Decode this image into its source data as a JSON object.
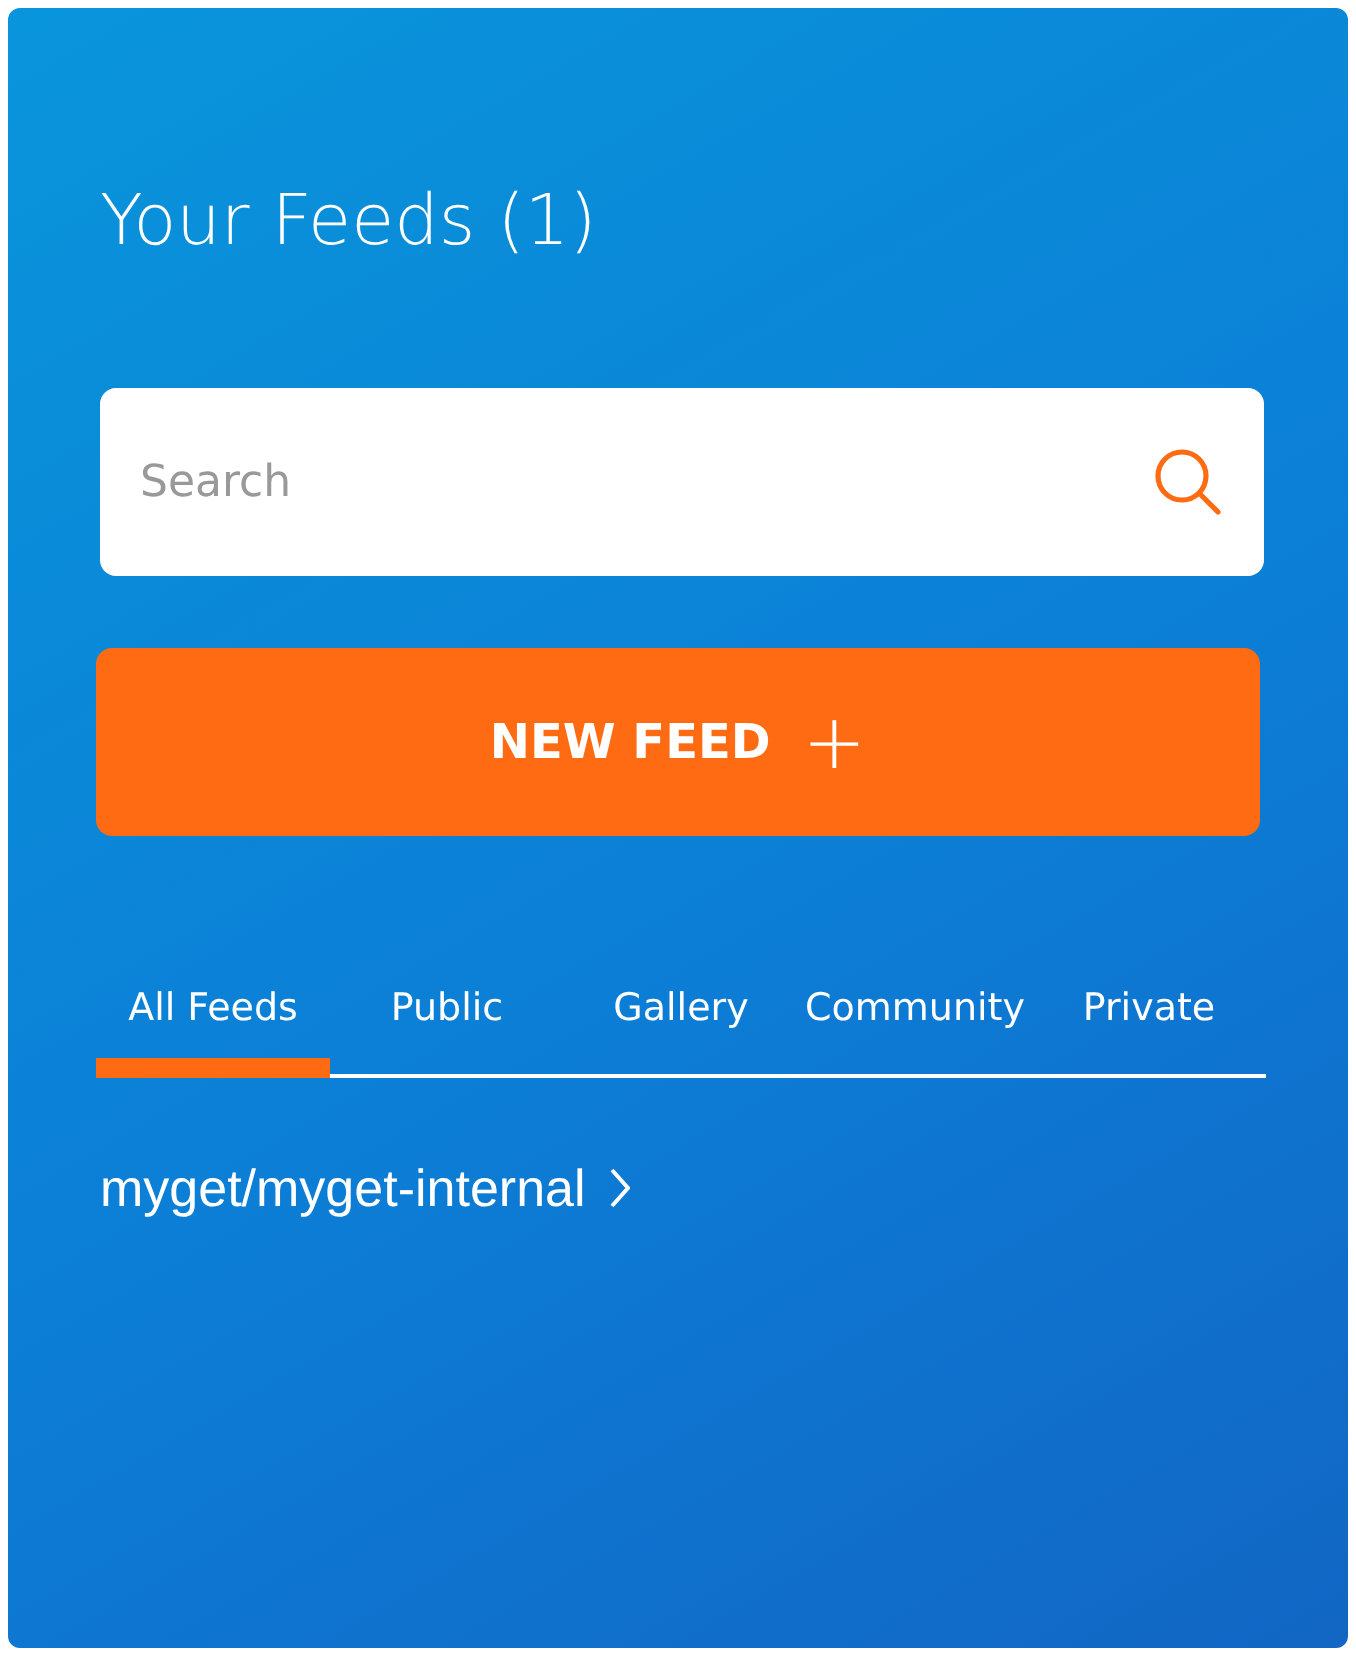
{
  "title": "Your Feeds (1)",
  "search": {
    "placeholder": "Search"
  },
  "new_feed_button": {
    "label": "NEW FEED",
    "icon": "+"
  },
  "tabs": [
    {
      "label": "All Feeds",
      "selected": true
    },
    {
      "label": "Public",
      "selected": false
    },
    {
      "label": "Gallery",
      "selected": false
    },
    {
      "label": "Community",
      "selected": false
    },
    {
      "label": "Private",
      "selected": false
    }
  ],
  "feeds": [
    {
      "name": "myget/myget-internal"
    }
  ]
}
